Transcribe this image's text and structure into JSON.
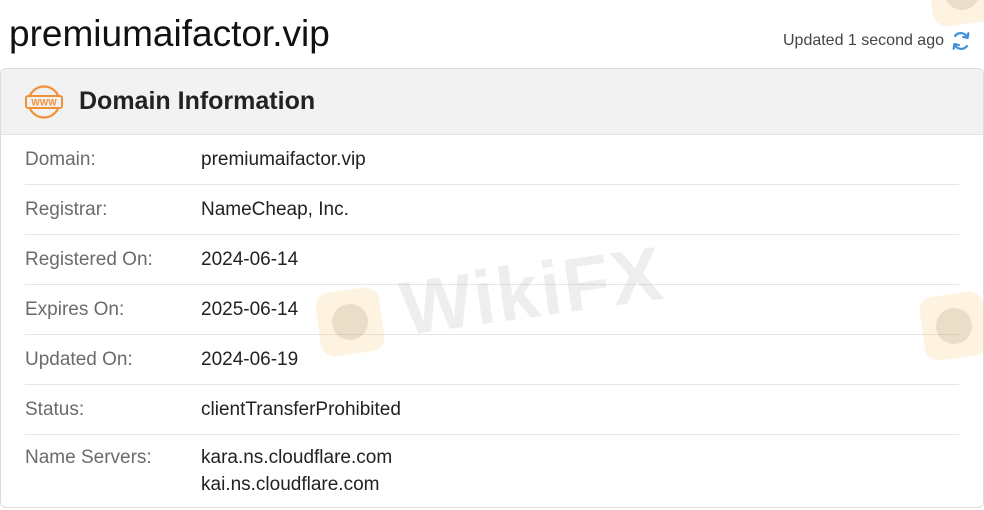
{
  "header": {
    "title": "premiumaifactor.vip",
    "updated_text": "Updated 1 second ago",
    "refresh_icon": "refresh-icon"
  },
  "card": {
    "icon": "www-globe-icon",
    "title": "Domain Information",
    "accent_color": "#f0913a"
  },
  "rows": [
    {
      "label": "Domain:",
      "value": "premiumaifactor.vip"
    },
    {
      "label": "Registrar:",
      "value": "NameCheap, Inc."
    },
    {
      "label": "Registered On:",
      "value": "2024-06-14"
    },
    {
      "label": "Expires On:",
      "value": "2025-06-14"
    },
    {
      "label": "Updated On:",
      "value": "2024-06-19"
    },
    {
      "label": "Status:",
      "value": "clientTransferProhibited"
    }
  ],
  "name_servers": {
    "label": "Name Servers:",
    "values": [
      "kara.ns.cloudflare.com",
      "kai.ns.cloudflare.com"
    ]
  },
  "watermark": {
    "text": "WikiFX"
  },
  "colors": {
    "refresh_blue": "#3d8fd9",
    "label_gray": "#6b6b6b"
  }
}
